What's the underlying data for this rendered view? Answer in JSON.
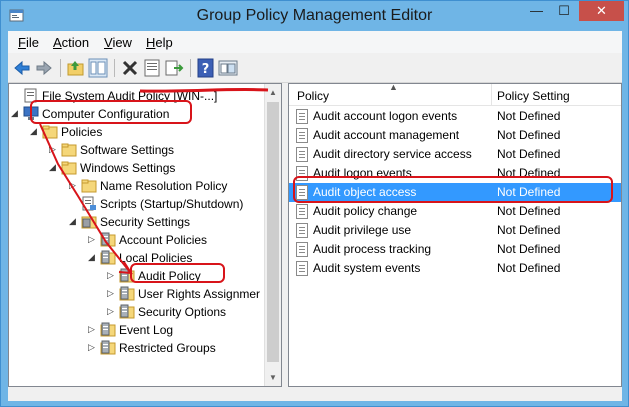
{
  "window": {
    "title": "Group Policy Management Editor",
    "minimize_glyph": "—",
    "maximize_glyph": "☐",
    "close_glyph": "✕"
  },
  "menu": [
    {
      "label": "File",
      "mnemonic": "F"
    },
    {
      "label": "Action",
      "mnemonic": "A"
    },
    {
      "label": "View",
      "mnemonic": "V"
    },
    {
      "label": "Help",
      "mnemonic": "H"
    }
  ],
  "toolbar": {
    "icons": [
      "back-arrow-icon",
      "forward-arrow-icon",
      "up-folder-icon",
      "show-hide-tree-icon",
      "delete-icon",
      "properties-icon",
      "export-list-icon",
      "help-icon",
      "mmc-icon"
    ]
  },
  "tree": {
    "items": [
      {
        "label": "File System Audit Policy [WIN-...]",
        "name": "tree-item-root",
        "icon": "gpo-icon",
        "expander": "",
        "level": 0
      },
      {
        "label": "Computer Configuration",
        "name": "tree-item-computer-configuration",
        "icon": "computer-icon",
        "expander": "◢",
        "level": 0
      },
      {
        "label": "Policies",
        "name": "tree-item-policies",
        "icon": "folder-icon",
        "expander": "◢",
        "level": 1
      },
      {
        "label": "Software Settings",
        "name": "tree-item-software-settings",
        "icon": "folder-icon",
        "expander": "▷",
        "level": 2
      },
      {
        "label": "Windows Settings",
        "name": "tree-item-windows-settings",
        "icon": "folder-icon",
        "expander": "◢",
        "level": 2
      },
      {
        "label": "Name Resolution Policy",
        "name": "tree-item-name-resolution-policy",
        "icon": "folder-icon",
        "expander": "▷",
        "level": 3
      },
      {
        "label": "Scripts (Startup/Shutdown)",
        "name": "tree-item-scripts",
        "icon": "scripts-icon",
        "expander": "",
        "level": 3
      },
      {
        "label": "Security Settings",
        "name": "tree-item-security-settings",
        "icon": "security-icon",
        "expander": "◢",
        "level": 3
      },
      {
        "label": "Account Policies",
        "name": "tree-item-account-policies",
        "icon": "policy-folder-icon",
        "expander": "▷",
        "level": 4
      },
      {
        "label": "Local Policies",
        "name": "tree-item-local-policies",
        "icon": "policy-folder-icon",
        "expander": "◢",
        "level": 4
      },
      {
        "label": "Audit Policy",
        "name": "tree-item-audit-policy",
        "icon": "policy-folder-icon",
        "expander": "▷",
        "level": 5
      },
      {
        "label": "User Rights Assignmer",
        "name": "tree-item-user-rights-assignment",
        "icon": "policy-folder-icon",
        "expander": "▷",
        "level": 5
      },
      {
        "label": "Security Options",
        "name": "tree-item-security-options",
        "icon": "policy-folder-icon",
        "expander": "▷",
        "level": 5
      },
      {
        "label": "Event Log",
        "name": "tree-item-event-log",
        "icon": "policy-folder-icon",
        "expander": "▷",
        "level": 4
      },
      {
        "label": "Restricted Groups",
        "name": "tree-item-restricted-groups",
        "icon": "policy-folder-icon",
        "expander": "▷",
        "level": 4
      }
    ]
  },
  "list": {
    "columns": [
      "Policy",
      "Policy Setting"
    ],
    "rows": [
      {
        "policy": "Audit account logon events",
        "setting": "Not Defined",
        "selected": false
      },
      {
        "policy": "Audit account management",
        "setting": "Not Defined",
        "selected": false
      },
      {
        "policy": "Audit directory service access",
        "setting": "Not Defined",
        "selected": false
      },
      {
        "policy": "Audit logon events",
        "setting": "Not Defined",
        "selected": false
      },
      {
        "policy": "Audit object access",
        "setting": "Not Defined",
        "selected": true
      },
      {
        "policy": "Audit policy change",
        "setting": "Not Defined",
        "selected": false
      },
      {
        "policy": "Audit privilege use",
        "setting": "Not Defined",
        "selected": false
      },
      {
        "policy": "Audit process tracking",
        "setting": "Not Defined",
        "selected": false
      },
      {
        "policy": "Audit system events",
        "setting": "Not Defined",
        "selected": false
      }
    ]
  },
  "colors": {
    "title_bar": "#6fb5e6",
    "selection": "#3399ff",
    "annotation": "#d8141a"
  }
}
